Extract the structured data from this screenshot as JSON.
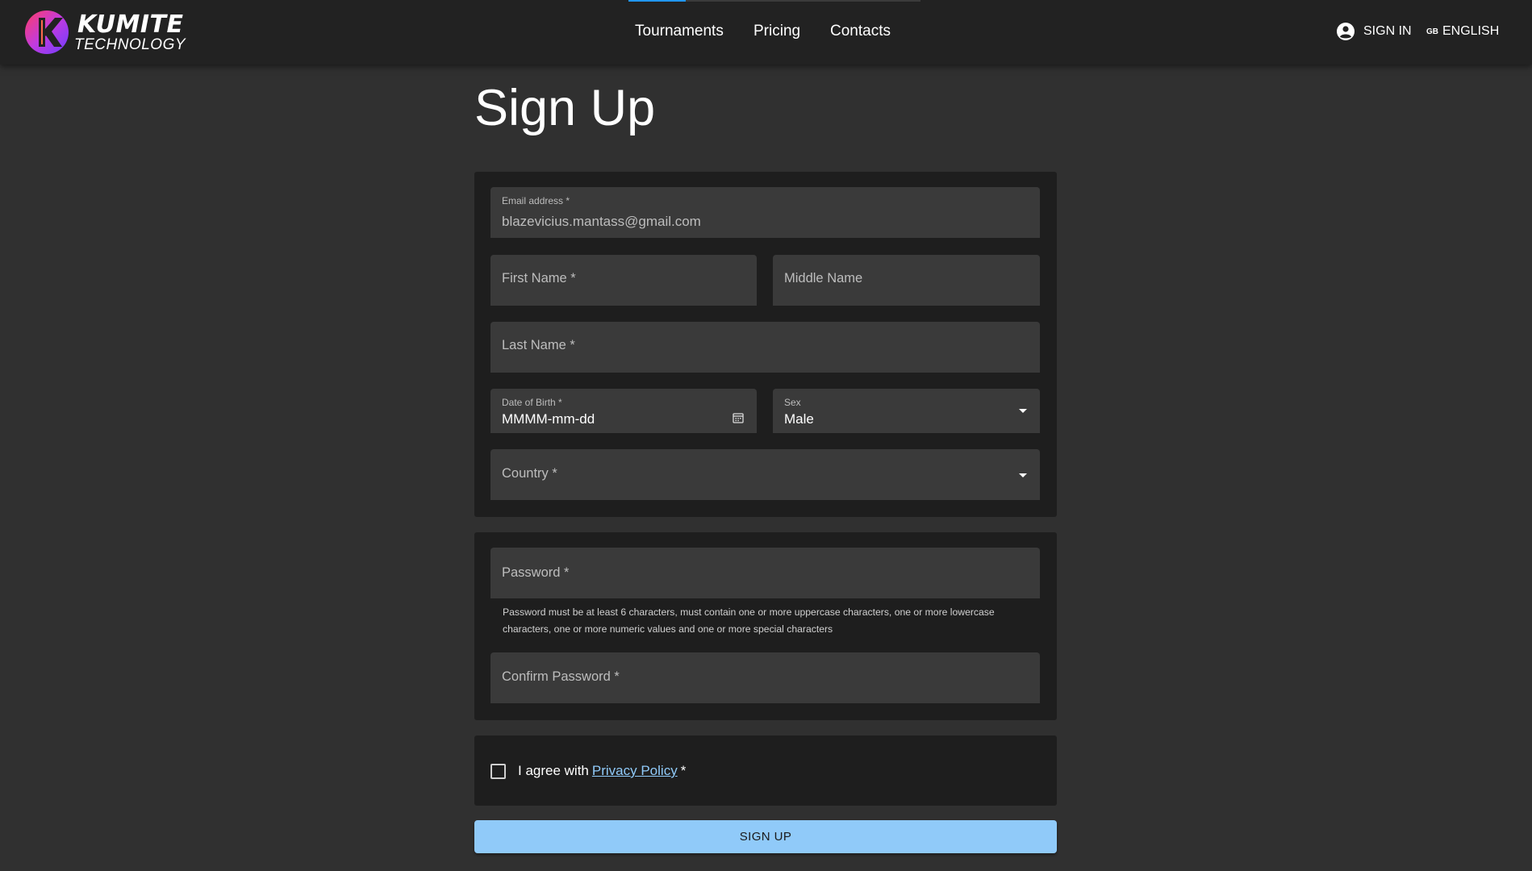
{
  "header": {
    "logo": {
      "name": "KUMITE",
      "subtitle": "TECHNOLOGY"
    },
    "nav": [
      {
        "label": "Tournaments",
        "active": true
      },
      {
        "label": "Pricing"
      },
      {
        "label": "Contacts"
      }
    ],
    "sign_in": "SIGN IN",
    "language": {
      "code": "GB",
      "label": "ENGLISH"
    },
    "accent_color": "#2196f3"
  },
  "page": {
    "title": "Sign Up"
  },
  "personal": {
    "email": {
      "label": "Email address *",
      "value": "blazevicius.mantass@gmail.com"
    },
    "first_name": {
      "label": "First Name *"
    },
    "middle_name": {
      "label": "Middle Name"
    },
    "last_name": {
      "label": "Last Name *"
    },
    "dob": {
      "label": "Date of Birth *",
      "value": "MMMM-mm-dd"
    },
    "sex": {
      "label": "Sex",
      "value": "Male"
    },
    "country": {
      "label": "Country *"
    }
  },
  "security": {
    "password": {
      "label": "Password *"
    },
    "helper": "Password must be at least 6 characters, must contain one or more uppercase characters, one or more lowercase characters, one or more numeric values and one or more special characters",
    "confirm": {
      "label": "Confirm Password *"
    }
  },
  "agreement": {
    "prefix": "I agree with",
    "link": "Privacy Policy",
    "suffix": "*",
    "checked": false
  },
  "submit": {
    "label": "SIGN UP",
    "color": "#90caf9"
  }
}
